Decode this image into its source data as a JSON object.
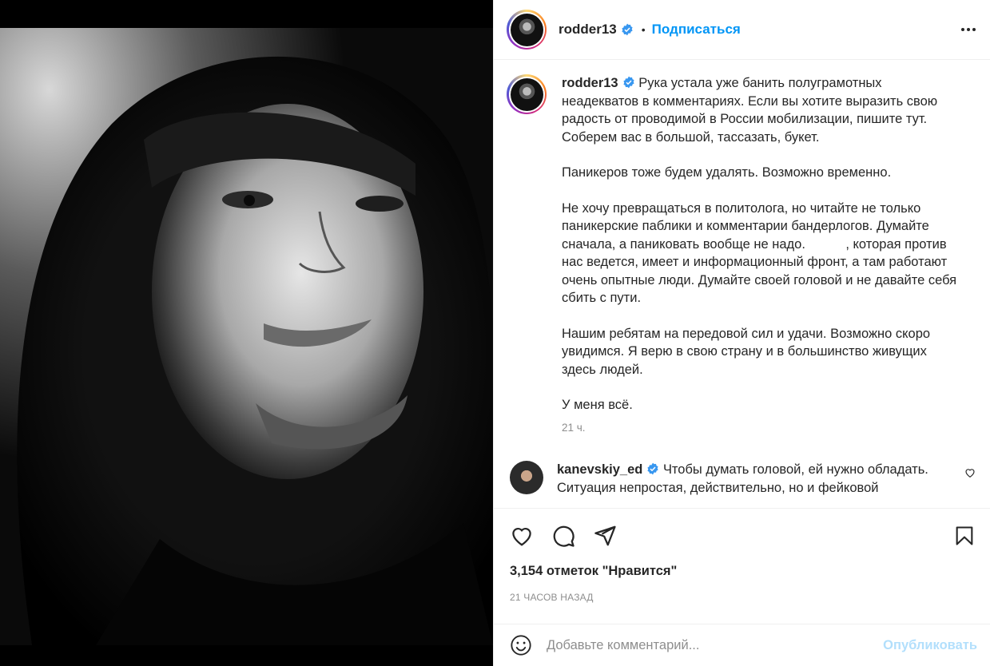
{
  "post": {
    "author": "rodder13",
    "follow_label": "Подписаться",
    "separator": "•",
    "caption_paragraphs": [
      "Рука устала уже банить полуграмотных неадекватов в комментариях. Если вы хотите выразить свою радость от проводимой в России мобилизации, пишите тут. Соберем вас в большой, тассазать, букет.",
      "Паникеров тоже будем удалять. Возможно временно.",
      "Не хочу превращаться в политолога, но читайте не только паникерские паблики и комментарии бандерлогов. Думайте сначала, а паниковать вообще не надо.           , которая против нас ведется, имеет и информационный фронт, а там работают очень опытные люди. Думайте своей головой и не давайте себя сбить с пути.",
      "Нашим ребятам на передовой сил и удачи. Возможно скоро увидимся. Я верю в свою страну и в большинство живущих здесь людей.",
      "У меня всё."
    ],
    "caption_time": "21 ч.",
    "likes_text": "3,154 отметок \"Нравится\"",
    "posted_ago": "21 часов назад"
  },
  "comments": [
    {
      "user": "kanevskiy_ed",
      "text": "Чтобы думать головой, ей нужно обладать. Ситуация непростая, действительно, но и фейковой"
    }
  ],
  "add_comment": {
    "placeholder": "Добавьте комментарий...",
    "publish_label": "Опубликовать"
  },
  "icons": {
    "verified": "verified-badge-icon",
    "more": "more-options-icon",
    "like": "heart-icon",
    "comment": "comment-icon",
    "share": "send-icon",
    "save": "bookmark-icon",
    "emoji": "emoji-icon"
  },
  "colors": {
    "accent": "#0095f6",
    "publish_disabled": "#b2dffc",
    "muted": "#8e8e8e",
    "text": "#262626"
  }
}
